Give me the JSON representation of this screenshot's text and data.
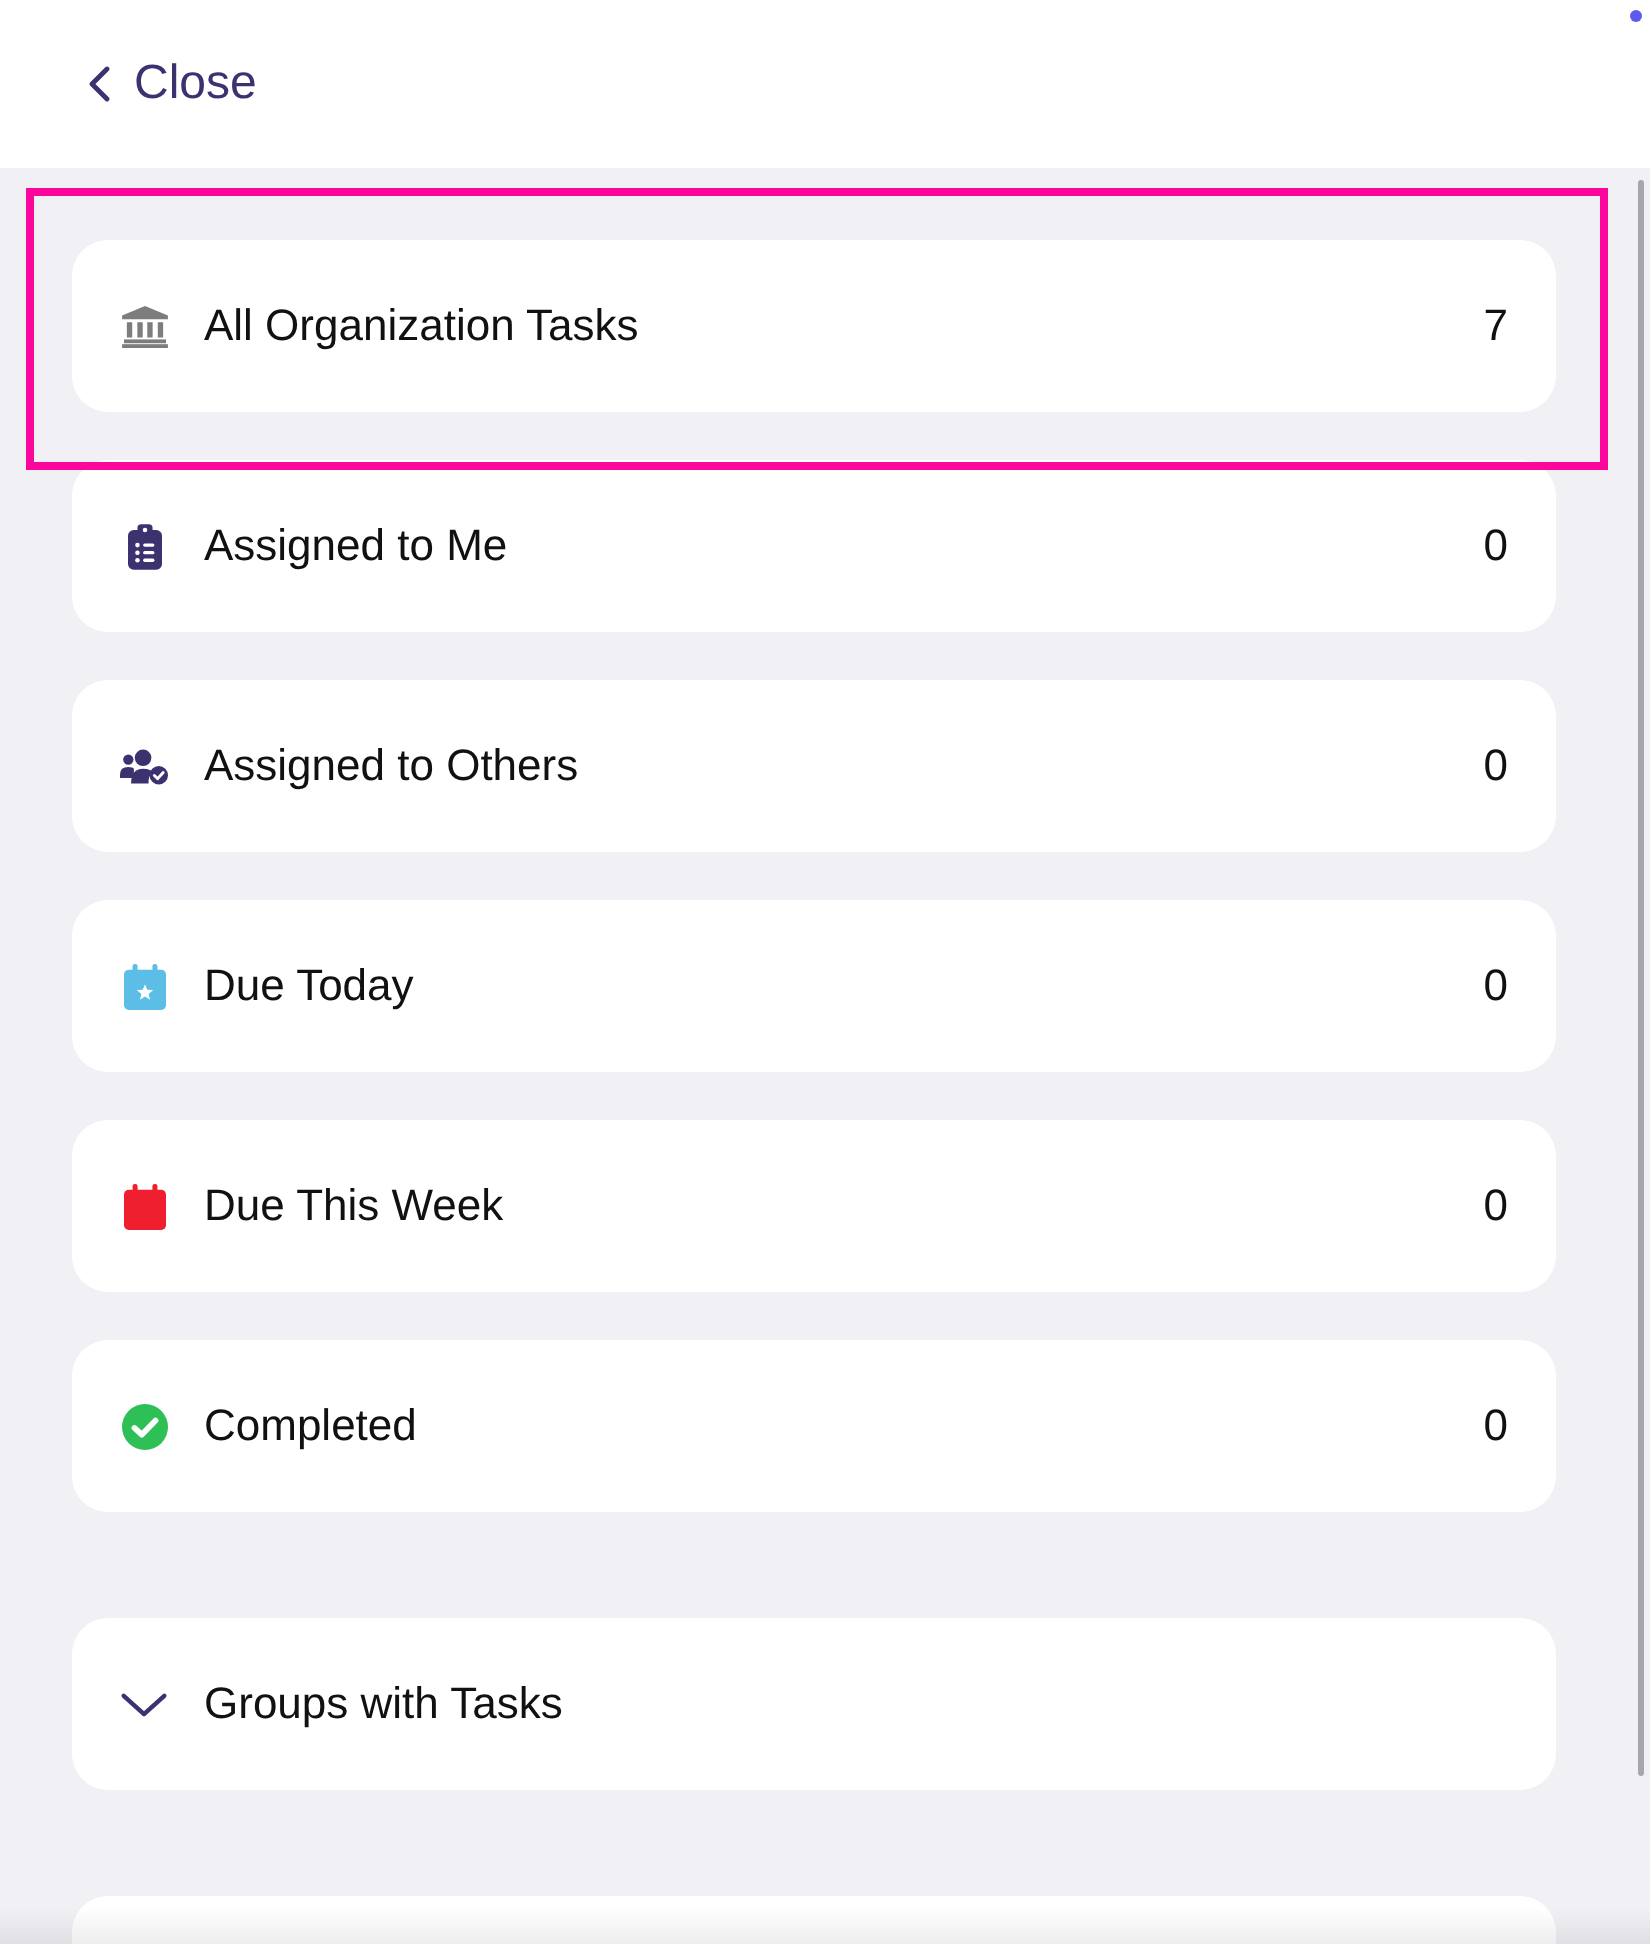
{
  "header": {
    "close_label": "Close"
  },
  "filters": [
    {
      "kind": "bank",
      "label": "All Organization Tasks",
      "count": "7",
      "highlighted": true
    },
    {
      "kind": "clipboard",
      "label": "Assigned to Me",
      "count": "0",
      "highlighted": false
    },
    {
      "kind": "users",
      "label": "Assigned to Others",
      "count": "0",
      "highlighted": false
    },
    {
      "kind": "calendar-star",
      "label": "Due Today",
      "count": "0",
      "highlighted": false
    },
    {
      "kind": "calendar",
      "label": "Due This Week",
      "count": "0",
      "highlighted": false
    },
    {
      "kind": "check",
      "label": "Completed",
      "count": "0",
      "highlighted": false
    }
  ],
  "groups_section": {
    "label": "Groups with Tasks",
    "expanded": false
  }
}
